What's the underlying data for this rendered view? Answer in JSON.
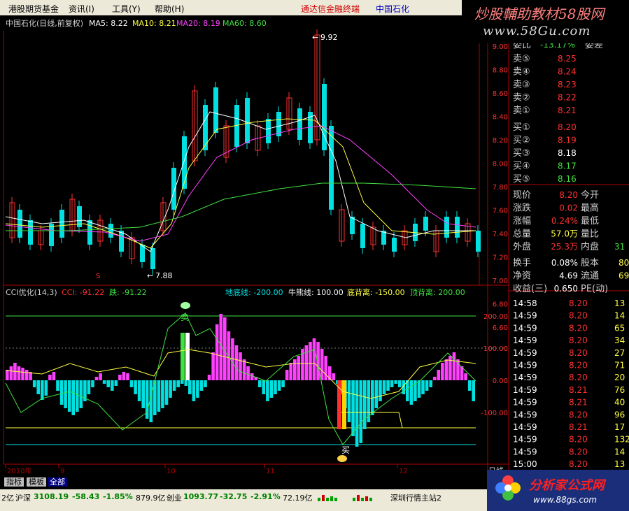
{
  "menubar": {
    "items": [
      "港股期货基金",
      "资讯(I)",
      "工具(Y)",
      "帮助(H)"
    ],
    "terminal": "通达信金融终端",
    "stock": "中国石化"
  },
  "banner": {
    "title": "炒股輔助教材58股网",
    "url": "www.58Gu.com"
  },
  "kline": {
    "title": "中国石化(日线,前复权)",
    "ma5": "MA5: 8.22",
    "ma10": "MA10: 8.21",
    "ma20": "MA20: 8.19",
    "ma60": "MA60: 8.60",
    "max_label": "9.92",
    "min_label": "7.88",
    "y_axis": [
      "9.00",
      "8.80",
      "8.60",
      "8.40",
      "8.20",
      "8.00",
      "7.80",
      "7.60",
      "7.40",
      "7.20",
      "7.00",
      "6.80",
      "6.60"
    ],
    "colors": {
      "up": "#ff3030",
      "down": "#00e0e0",
      "ma5": "#ffffff",
      "ma10": "#ffff40",
      "ma20": "#ff40ff",
      "ma60": "#40e040"
    }
  },
  "cci": {
    "title": "CCI优化(14,3)",
    "cci_value": "CCI: -91.22",
    "die": "跌: -91.22",
    "floor": "地底线: -200.00",
    "bull": "牛熊线: 100.00",
    "bottom_div": "底背离: -150.00",
    "top_div": "顶背离: 200.00",
    "y_axis": [
      "200.00",
      "100.00",
      "0.00",
      "-100.00"
    ],
    "marker_top": "卖",
    "marker_bottom": "买"
  },
  "x_axis": {
    "labels": [
      "2010年",
      "9",
      "10",
      "11",
      "12"
    ],
    "period": "日线"
  },
  "quote": {
    "weibi_label": "委比",
    "weibi_value": "-13.17%",
    "weicha_label": "委差",
    "asks": [
      {
        "label": "卖⑤",
        "price": "8.25"
      },
      {
        "label": "卖④",
        "price": "8.24"
      },
      {
        "label": "卖③",
        "price": "8.23"
      },
      {
        "label": "卖②",
        "price": "8.22"
      },
      {
        "label": "卖①",
        "price": "8.21"
      }
    ],
    "bids": [
      {
        "label": "买①",
        "price": "8.20"
      },
      {
        "label": "买②",
        "price": "8.19"
      },
      {
        "label": "买③",
        "price": "8.18"
      },
      {
        "label": "买④",
        "price": "8.17"
      },
      {
        "label": "买⑤",
        "price": "8.16"
      }
    ],
    "stats": [
      {
        "l": "现价",
        "v": "8.20",
        "l2": "今开"
      },
      {
        "l": "涨跌",
        "v": "0.02",
        "l2": "最高"
      },
      {
        "l": "涨幅",
        "v": "0.24%",
        "l2": "最低"
      },
      {
        "l": "总量",
        "v": "57.0万",
        "l2": "量比"
      },
      {
        "l": "外盘",
        "v": "25.3万",
        "l2": "内盘",
        "v2": "31"
      }
    ],
    "stats2": [
      {
        "l": "换手",
        "v": "0.08%",
        "l2": "股本",
        "v2": "80"
      },
      {
        "l": "净资",
        "v": "4.69",
        "l2": "流通",
        "v2": "69"
      },
      {
        "l": "收益(三)",
        "v": "0.650",
        "l2": "PE(动)"
      }
    ],
    "ticks": [
      {
        "t": "14:58",
        "p": "8.20",
        "v": "13"
      },
      {
        "t": "14:59",
        "p": "8.20",
        "v": "14"
      },
      {
        "t": "14:59",
        "p": "8.20",
        "v": "65"
      },
      {
        "t": "14:59",
        "p": "8.20",
        "v": "34"
      },
      {
        "t": "14:59",
        "p": "8.20",
        "v": "27"
      },
      {
        "t": "14:59",
        "p": "8.20",
        "v": "71"
      },
      {
        "t": "14:59",
        "p": "8.20",
        "v": "20"
      },
      {
        "t": "14:59",
        "p": "8.21",
        "v": "76"
      },
      {
        "t": "14:59",
        "p": "8.21",
        "v": "40"
      },
      {
        "t": "14:59",
        "p": "8.20",
        "v": "96"
      },
      {
        "t": "14:59",
        "p": "8.21",
        "v": "17"
      },
      {
        "t": "14:59",
        "p": "8.20",
        "v": "132"
      },
      {
        "t": "14:59",
        "p": "8.20",
        "v": "14"
      },
      {
        "t": "15:00",
        "p": "8.20",
        "v": "13"
      }
    ]
  },
  "toolbar": {
    "tabs": [
      "指标",
      "模板",
      "全部"
    ]
  },
  "status": {
    "left": "2亿",
    "sh_label": "沪深",
    "sh_index": "3108.19",
    "sh_change": "-58.43",
    "sh_pct": "-1.85%",
    "sh_amount": "879.9亿",
    "cy_label": "创业",
    "cy_index": "1093.77",
    "cy_change": "-32.75",
    "cy_pct": "-2.91%",
    "cy_amount": "72.19亿",
    "server": "深圳行情主站2"
  },
  "logo": {
    "title": "分析家公式网",
    "url": "www.88gs.com"
  }
}
